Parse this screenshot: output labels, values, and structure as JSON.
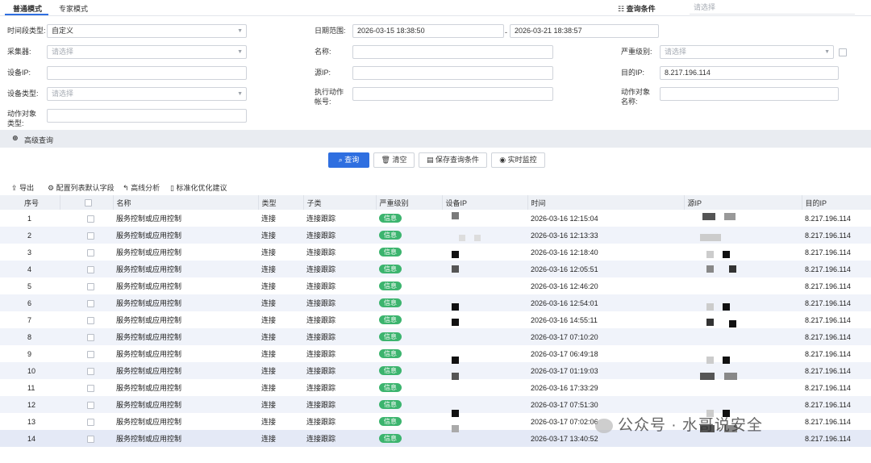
{
  "tabs": [
    "普通模式",
    "专家模式"
  ],
  "query_conditions": {
    "label": "查询条件",
    "placeholder": "请选择"
  },
  "form": {
    "time_type_label": "时间段类型:",
    "time_type_value": "自定义",
    "date_range_label": "日期范围:",
    "date_start": "2026-03-15 18:38:50",
    "date_sep": "-",
    "date_end": "2026-03-21 18:38:57",
    "collector_label": "采集器:",
    "collector_placeholder": "请选择",
    "name_label": "名称:",
    "severity_label": "严重级别:",
    "severity_placeholder": "请选择",
    "device_ip_label": "设备IP:",
    "src_ip_label": "源IP:",
    "dst_ip_label": "目的IP:",
    "dst_ip_value": "8.217.196.114",
    "device_type_label": "设备类型:",
    "device_type_placeholder": "请选择",
    "exec_account_label": "执行动作帐号:",
    "action_object_name_label": "动作对象名称:",
    "action_object_type_label": "动作对象类型:"
  },
  "advanced_query": "高级查询",
  "buttons": {
    "query": "查询",
    "clear": "清空",
    "save": "保存查询条件",
    "monitor": "实时监控"
  },
  "toolbar": {
    "export": "导出",
    "config_fields": "配置列表默认字段",
    "trace": "高线分析",
    "standardize": "标准化优化建议"
  },
  "table": {
    "headers": [
      "序号",
      "",
      "名称",
      "类型",
      "子类",
      "严重级别",
      "设备IP",
      "时间",
      "源IP",
      "目的IP"
    ],
    "rows": [
      {
        "no": "1",
        "name": "服务控制或应用控制",
        "type": "连接",
        "subtype": "连接跟踪",
        "severity": "信息",
        "time": "2026-03-16 12:15:04",
        "dst": "8.217.196.114"
      },
      {
        "no": "2",
        "name": "服务控制或应用控制",
        "type": "连接",
        "subtype": "连接跟踪",
        "severity": "信息",
        "time": "2026-03-16 12:13:33",
        "dst": "8.217.196.114"
      },
      {
        "no": "3",
        "name": "服务控制或应用控制",
        "type": "连接",
        "subtype": "连接跟踪",
        "severity": "信息",
        "time": "2026-03-16 12:18:40",
        "dst": "8.217.196.114"
      },
      {
        "no": "4",
        "name": "服务控制或应用控制",
        "type": "连接",
        "subtype": "连接跟踪",
        "severity": "信息",
        "time": "2026-03-16 12:05:51",
        "dst": "8.217.196.114"
      },
      {
        "no": "5",
        "name": "服务控制或应用控制",
        "type": "连接",
        "subtype": "连接跟踪",
        "severity": "信息",
        "time": "2026-03-16 12:46:20",
        "dst": "8.217.196.114"
      },
      {
        "no": "6",
        "name": "服务控制或应用控制",
        "type": "连接",
        "subtype": "连接跟踪",
        "severity": "信息",
        "time": "2026-03-16 12:54:01",
        "dst": "8.217.196.114"
      },
      {
        "no": "7",
        "name": "服务控制或应用控制",
        "type": "连接",
        "subtype": "连接跟踪",
        "severity": "信息",
        "time": "2026-03-16 14:55:11",
        "dst": "8.217.196.114"
      },
      {
        "no": "8",
        "name": "服务控制或应用控制",
        "type": "连接",
        "subtype": "连接跟踪",
        "severity": "信息",
        "time": "2026-03-17 07:10:20",
        "dst": "8.217.196.114"
      },
      {
        "no": "9",
        "name": "服务控制或应用控制",
        "type": "连接",
        "subtype": "连接跟踪",
        "severity": "信息",
        "time": "2026-03-17 06:49:18",
        "dst": "8.217.196.114"
      },
      {
        "no": "10",
        "name": "服务控制或应用控制",
        "type": "连接",
        "subtype": "连接跟踪",
        "severity": "信息",
        "time": "2026-03-17 01:19:03",
        "dst": "8.217.196.114"
      },
      {
        "no": "11",
        "name": "服务控制或应用控制",
        "type": "连接",
        "subtype": "连接跟踪",
        "severity": "信息",
        "time": "2026-03-16 17:33:29",
        "dst": "8.217.196.114"
      },
      {
        "no": "12",
        "name": "服务控制或应用控制",
        "type": "连接",
        "subtype": "连接跟踪",
        "severity": "信息",
        "time": "2026-03-17 07:51:30",
        "dst": "8.217.196.114"
      },
      {
        "no": "13",
        "name": "服务控制或应用控制",
        "type": "连接",
        "subtype": "连接跟踪",
        "severity": "信息",
        "time": "2026-03-17 07:02:06",
        "dst": "8.217.196.114"
      },
      {
        "no": "14",
        "name": "服务控制或应用控制",
        "type": "连接",
        "subtype": "连接跟踪",
        "severity": "信息",
        "time": "2026-03-17 13:40:52",
        "dst": "8.217.196.114"
      }
    ]
  },
  "watermark": "公众号 · 水哥说安全",
  "colors": {
    "primary": "#2f6fe0",
    "badge": "#3cb46e",
    "header_bg": "#eef1f6",
    "alt_row": "#f0f3fa"
  }
}
